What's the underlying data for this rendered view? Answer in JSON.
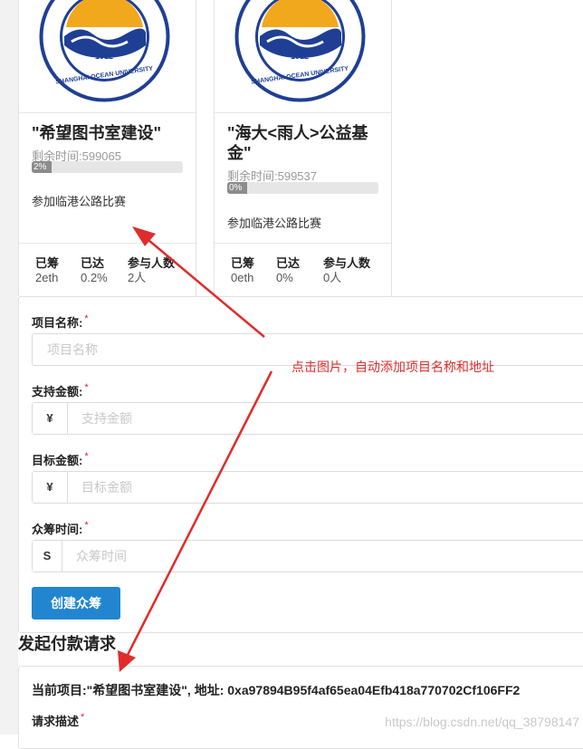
{
  "cards": [
    {
      "title": "\"希望图书室建设\"",
      "remaining": "剩余时间:599065",
      "progress_label": "2%",
      "progress": 2,
      "description": "参加临港公路比赛",
      "stats": [
        {
          "label": "已筹",
          "value": "2eth"
        },
        {
          "label": "已达",
          "value": "0.2%"
        },
        {
          "label": "参与人数",
          "value": "2人"
        }
      ]
    },
    {
      "title": "\"海大<雨人>公益基金\"",
      "remaining": "剩余时间:599537",
      "progress_label": "0%",
      "progress": 0,
      "description": "参加临港公路比赛",
      "stats": [
        {
          "label": "已筹",
          "value": "0eth"
        },
        {
          "label": "已达",
          "value": "0%"
        },
        {
          "label": "参与人数",
          "value": "0人"
        }
      ]
    }
  ],
  "logo": {
    "year": "1912",
    "university": "SHANGHAI OCEAN UNIVERSITY",
    "icon": "university-seal-icon"
  },
  "form": {
    "project_name": {
      "label": "项目名称:",
      "required_mark": "*",
      "placeholder": "项目名称"
    },
    "support_amount": {
      "label": "支持金额:",
      "required_mark": "*",
      "addon": "¥",
      "placeholder": "支持金额"
    },
    "target_amount": {
      "label": "目标金额:",
      "required_mark": "*",
      "addon": "¥",
      "placeholder": "目标金额"
    },
    "duration": {
      "label": "众筹时间:",
      "required_mark": "*",
      "addon": "S",
      "placeholder": "众筹时间"
    },
    "submit_label": "创建众筹"
  },
  "payment": {
    "section_title": "发起付款请求",
    "current_project": "当前项目:\"希望图书室建设\", 地址: 0xa97894B95f4af65ea04Efb418a770702Cf106FF2",
    "request_desc_label": "请求描述",
    "required_mark": "*"
  },
  "annotation": "点击图片，自动添加项目名称和地址",
  "watermark": "https://blog.csdn.net/qq_38798147",
  "colors": {
    "primary": "#2185d0",
    "annotation": "#e02c2c",
    "required": "#db2828",
    "seal_blue": "#1f3f94",
    "seal_gold": "#f2a81d"
  }
}
